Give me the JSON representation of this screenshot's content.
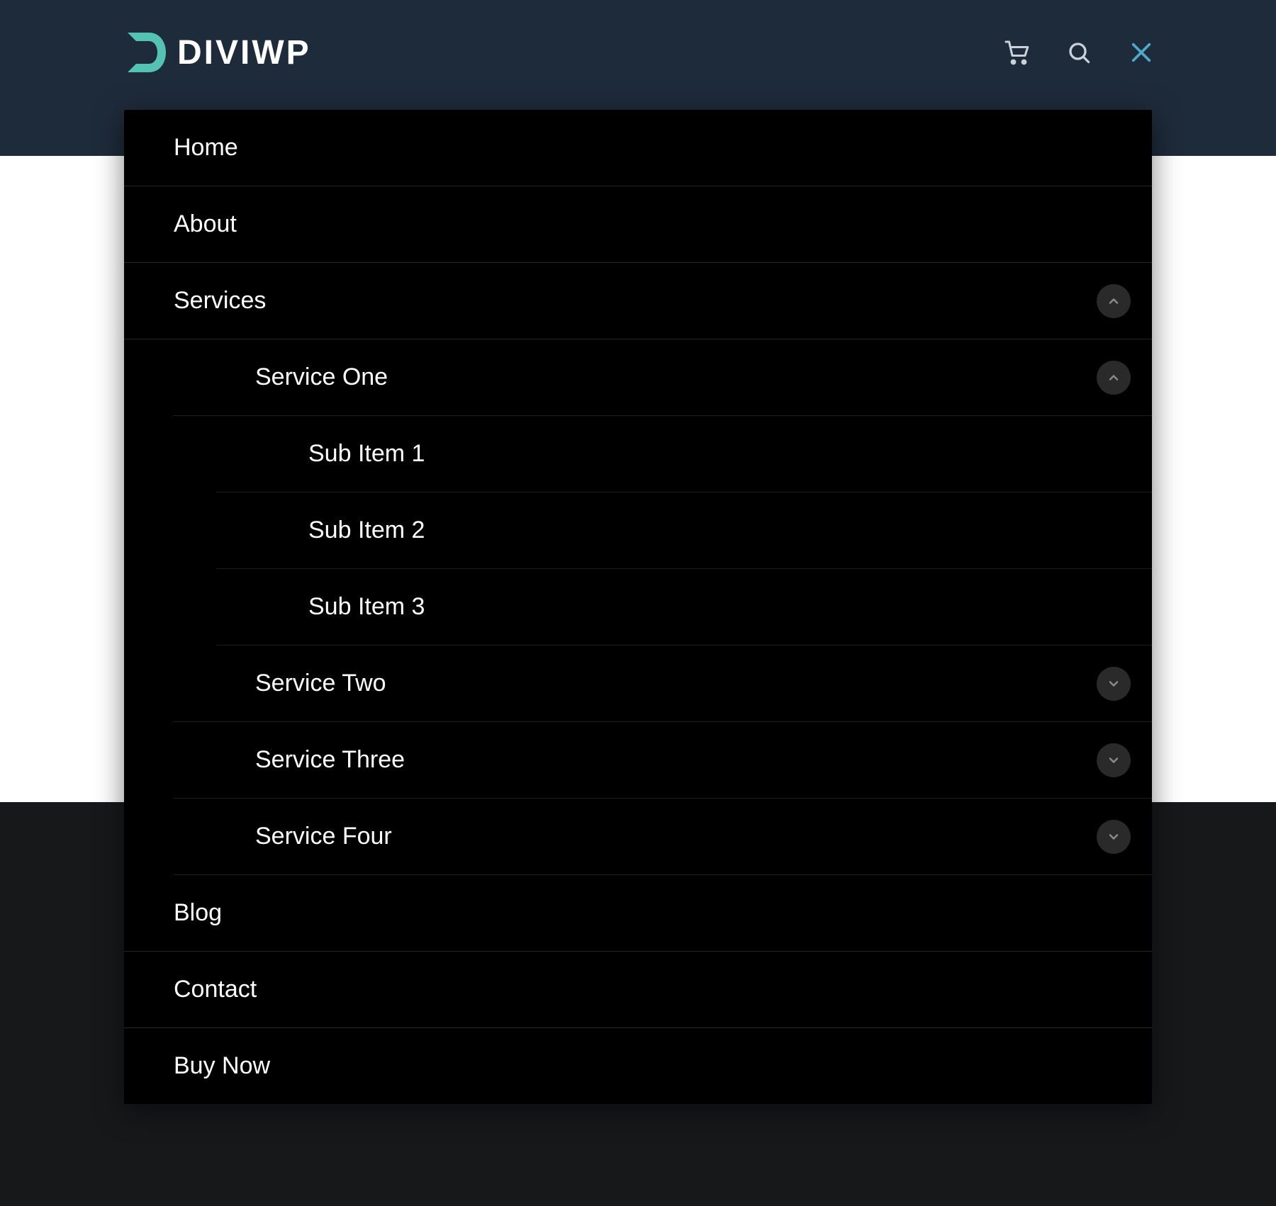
{
  "brand": {
    "name": "DIVIWP"
  },
  "menu": {
    "items": [
      {
        "label": "Home"
      },
      {
        "label": "About"
      },
      {
        "label": "Services",
        "toggle": "up"
      },
      {
        "label": "Service One",
        "level": 1,
        "toggle": "up"
      },
      {
        "label": "Sub Item 1",
        "level": 2
      },
      {
        "label": "Sub Item 2",
        "level": 2
      },
      {
        "label": "Sub Item 3",
        "level": 2
      },
      {
        "label": "Service Two",
        "level": 1,
        "toggle": "down"
      },
      {
        "label": "Service Three",
        "level": 1,
        "toggle": "down"
      },
      {
        "label": "Service Four",
        "level": 1,
        "toggle": "down"
      },
      {
        "label": "Blog"
      },
      {
        "label": "Contact"
      },
      {
        "label": "Buy Now"
      }
    ]
  },
  "colors": {
    "header_bg": "#1e2b3a",
    "accent": "#55c3b3",
    "close_icon": "#4fa8c9",
    "footer_bg": "#17181a"
  }
}
